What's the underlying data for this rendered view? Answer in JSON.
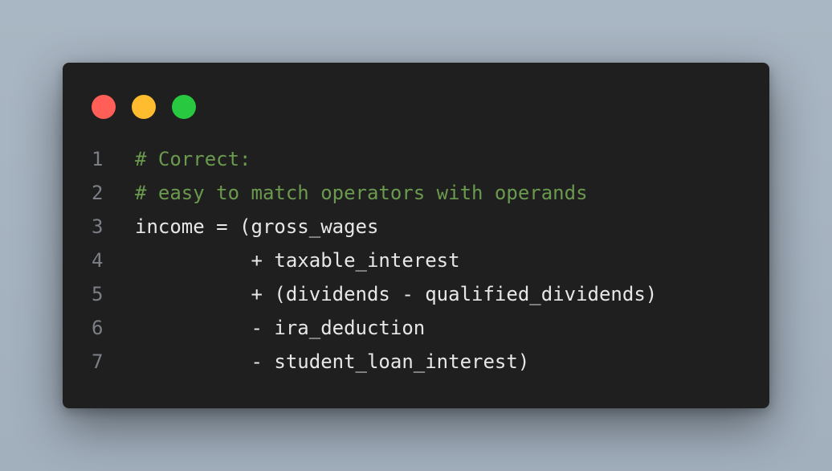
{
  "window": {
    "controls": [
      "close-button",
      "minimize-button",
      "maximize-button"
    ]
  },
  "code": {
    "lines": [
      {
        "number": "1",
        "text": "# Correct:",
        "kind": "comment"
      },
      {
        "number": "2",
        "text": "# easy to match operators with operands",
        "kind": "comment"
      },
      {
        "number": "3",
        "text": "income = (gross_wages",
        "kind": "code"
      },
      {
        "number": "4",
        "text": "          + taxable_interest",
        "kind": "code"
      },
      {
        "number": "5",
        "text": "          + (dividends - qualified_dividends)",
        "kind": "code"
      },
      {
        "number": "6",
        "text": "          - ira_deduction",
        "kind": "code"
      },
      {
        "number": "7",
        "text": "          - student_loan_interest)",
        "kind": "code"
      }
    ]
  },
  "colors": {
    "background": "#a9b6c3",
    "window": "#1f1f1f",
    "close": "#ff5f57",
    "minimize": "#febc2e",
    "maximize": "#28c840",
    "comment": "#6a9a4e",
    "code_text": "#e7e7e7",
    "line_number": "#7b7f86"
  }
}
